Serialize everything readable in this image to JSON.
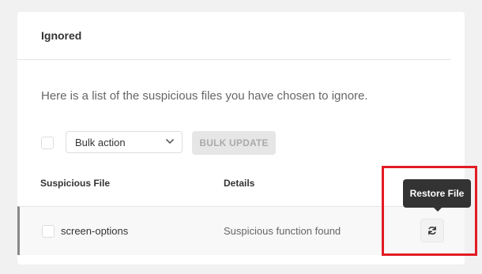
{
  "card": {
    "title": "Ignored",
    "description": "Here is a list of the suspicious files you have chosen to ignore."
  },
  "bulk": {
    "select_label": "Bulk action",
    "update_label": "BULK UPDATE"
  },
  "table": {
    "headers": [
      "Suspicious File",
      "Details"
    ],
    "rows": [
      {
        "file": "screen-options",
        "details": "Suspicious function found"
      }
    ]
  },
  "tooltip": {
    "label": "Restore File"
  },
  "icons": {
    "restore": "refresh-icon",
    "select": "chevron-down-icon"
  },
  "colors": {
    "highlight": "#e31b23",
    "tooltip_bg": "#333333"
  }
}
